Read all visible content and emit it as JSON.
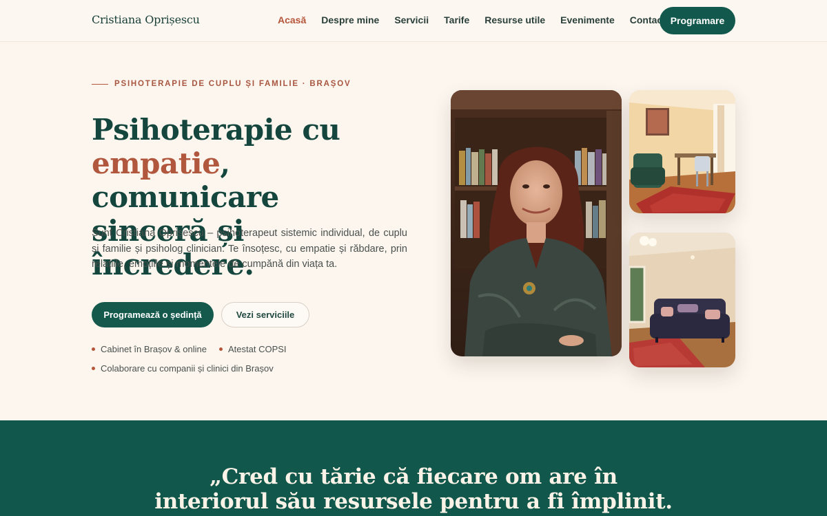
{
  "header": {
    "logo": "Cristiana Oprișescu",
    "nav": [
      "Acasă",
      "Despre mine",
      "Servicii",
      "Tarife",
      "Resurse utile",
      "Evenimente",
      "Contact"
    ],
    "cta": "Programare"
  },
  "hero": {
    "eyebrow": "PSIHOTERAPIE DE CUPLU ȘI FAMILIE · BRAȘOV",
    "headline_line1": "Psihoterapie cu",
    "headline_accent": "empatie",
    "headline_rest2": ", comunicare",
    "headline_line3": "sinceră și încredere.",
    "intro": "Sunt Cristiana Oprișescu – psihoterapeut sistemic individual, de cuplu și familie și psiholog clinician. Te însoțesc, cu empatie și răbdare, prin relațiile, emoțiile și momentele de cumpănă din viața ta.",
    "btn_primary": "Programează o ședință",
    "btn_secondary": "Vezi serviciile",
    "bullets": [
      "Cabinet în Brașov & online",
      "Atestat COPSI",
      "Colaborare cu companii și clinici din Brașov"
    ]
  },
  "quote": {
    "line1": "„Cred cu tărie că fiecare om are în",
    "line2": "interiorul său resursele pentru a fi împlinit."
  },
  "colors": {
    "brand_green": "#12584c",
    "accent_terracotta": "#b5553a",
    "background": "#fcf6ef"
  }
}
